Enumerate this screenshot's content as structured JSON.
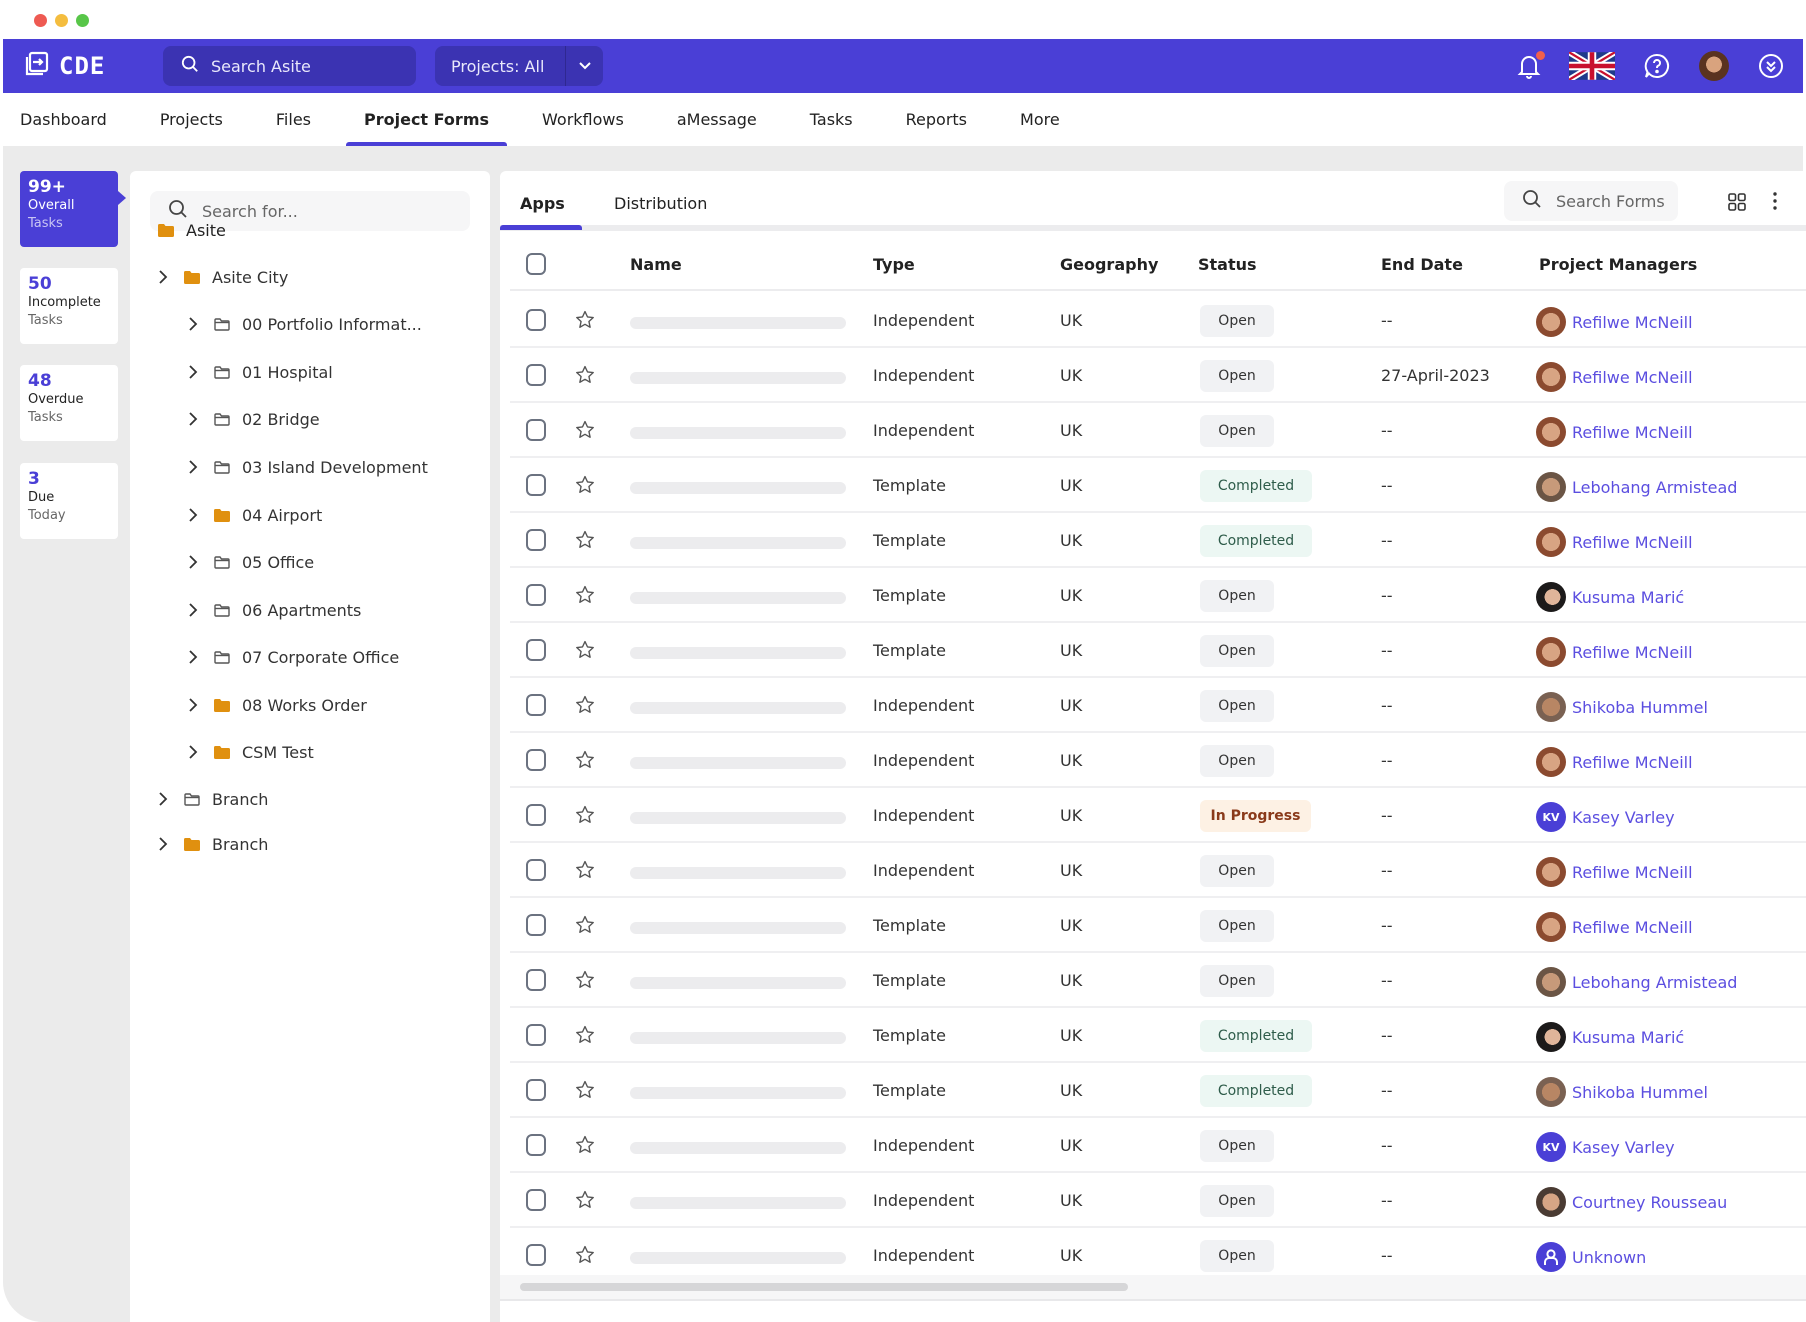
{
  "header": {
    "logo_text": "CDE",
    "search_placeholder": "Search Asite",
    "projects_filter": "Projects: All",
    "icons": [
      "bell-icon",
      "uk-flag-icon",
      "help-icon",
      "user-avatar",
      "chevrons-down-icon"
    ]
  },
  "nav": {
    "items": [
      {
        "label": "Dashboard"
      },
      {
        "label": "Projects"
      },
      {
        "label": "Files"
      },
      {
        "label": "Project Forms",
        "active": true
      },
      {
        "label": "Workflows"
      },
      {
        "label": "aMessage"
      },
      {
        "label": "Tasks"
      },
      {
        "label": "Reports"
      },
      {
        "label": "More"
      }
    ]
  },
  "stats": [
    {
      "value": "99+",
      "line1": "Overall",
      "line2": "Tasks",
      "active": true
    },
    {
      "value": "50",
      "line1": "Incomplete",
      "line2": "Tasks"
    },
    {
      "value": "48",
      "line1": "Overdue",
      "line2": "Tasks"
    },
    {
      "value": "3",
      "line1": "Due",
      "line2": "Today"
    }
  ],
  "tree": {
    "search_placeholder": "Search for...",
    "items": [
      {
        "label": "Asite",
        "level": 0,
        "folder": "filled",
        "chevron": false
      },
      {
        "label": "Asite City",
        "level": 1,
        "folder": "filled",
        "chevron": true
      },
      {
        "label": "00 Portfolio Informat...",
        "level": 2,
        "folder": "outline",
        "chevron": true
      },
      {
        "label": "01 Hospital",
        "level": 2,
        "folder": "outline",
        "chevron": true
      },
      {
        "label": "02 Bridge",
        "level": 2,
        "folder": "outline",
        "chevron": true
      },
      {
        "label": "03 Island Development",
        "level": 2,
        "folder": "outline",
        "chevron": true
      },
      {
        "label": "04 Airport",
        "level": 2,
        "folder": "filled",
        "chevron": true
      },
      {
        "label": "05 Office",
        "level": 2,
        "folder": "outline",
        "chevron": true
      },
      {
        "label": "06 Apartments",
        "level": 2,
        "folder": "outline",
        "chevron": true
      },
      {
        "label": "07 Corporate Office",
        "level": 2,
        "folder": "outline",
        "chevron": true
      },
      {
        "label": "08 Works Order",
        "level": 2,
        "folder": "filled",
        "chevron": true
      },
      {
        "label": "CSM Test",
        "level": 2,
        "folder": "filled",
        "chevron": true
      },
      {
        "label": "Branch",
        "level": 1,
        "folder": "outline",
        "chevron": true
      },
      {
        "label": "Branch",
        "level": 1,
        "folder": "filled",
        "chevron": true
      }
    ]
  },
  "main": {
    "tabs": [
      {
        "label": "Apps",
        "active": true
      },
      {
        "label": "Distribution"
      }
    ],
    "search_placeholder": "Search Forms",
    "columns": {
      "name": "Name",
      "type": "Type",
      "geography": "Geography",
      "status": "Status",
      "end_date": "End Date",
      "project_managers": "Project Managers"
    },
    "rows": [
      {
        "type": "Independent",
        "geography": "UK",
        "status": "Open",
        "end_date": "--",
        "pm": "Refilwe McNeill",
        "avatar": "photo1"
      },
      {
        "type": "Independent",
        "geography": "UK",
        "status": "Open",
        "end_date": "27-April-2023",
        "pm": "Refilwe McNeill",
        "avatar": "photo1"
      },
      {
        "type": "Independent",
        "geography": "UK",
        "status": "Open",
        "end_date": "--",
        "pm": "Refilwe McNeill",
        "avatar": "photo1"
      },
      {
        "type": "Template",
        "geography": "UK",
        "status": "Completed",
        "end_date": "--",
        "pm": "Lebohang Armistead",
        "avatar": "photo2"
      },
      {
        "type": "Template",
        "geography": "UK",
        "status": "Completed",
        "end_date": "--",
        "pm": "Refilwe McNeill",
        "avatar": "photo1"
      },
      {
        "type": "Template",
        "geography": "UK",
        "status": "Open",
        "end_date": "--",
        "pm": "Kusuma Marić",
        "avatar": "photo3"
      },
      {
        "type": "Template",
        "geography": "UK",
        "status": "Open",
        "end_date": "--",
        "pm": "Refilwe McNeill",
        "avatar": "photo1"
      },
      {
        "type": "Independent",
        "geography": "UK",
        "status": "Open",
        "end_date": "--",
        "pm": "Shikoba Hummel",
        "avatar": "photo4"
      },
      {
        "type": "Independent",
        "geography": "UK",
        "status": "Open",
        "end_date": "--",
        "pm": "Refilwe McNeill",
        "avatar": "photo1"
      },
      {
        "type": "Independent",
        "geography": "UK",
        "status": "In Progress",
        "end_date": "--",
        "pm": "Kasey Varley",
        "avatar": "initials",
        "initials": "KV"
      },
      {
        "type": "Independent",
        "geography": "UK",
        "status": "Open",
        "end_date": "--",
        "pm": "Refilwe McNeill",
        "avatar": "photo1"
      },
      {
        "type": "Template",
        "geography": "UK",
        "status": "Open",
        "end_date": "--",
        "pm": "Refilwe McNeill",
        "avatar": "photo1"
      },
      {
        "type": "Template",
        "geography": "UK",
        "status": "Open",
        "end_date": "--",
        "pm": "Lebohang Armistead",
        "avatar": "photo2"
      },
      {
        "type": "Template",
        "geography": "UK",
        "status": "Completed",
        "end_date": "--",
        "pm": "Kusuma Marić",
        "avatar": "photo3"
      },
      {
        "type": "Template",
        "geography": "UK",
        "status": "Completed",
        "end_date": "--",
        "pm": "Shikoba Hummel",
        "avatar": "photo4"
      },
      {
        "type": "Independent",
        "geography": "UK",
        "status": "Open",
        "end_date": "--",
        "pm": "Kasey Varley",
        "avatar": "initials",
        "initials": "KV"
      },
      {
        "type": "Independent",
        "geography": "UK",
        "status": "Open",
        "end_date": "--",
        "pm": "Courtney Rousseau",
        "avatar": "photo5"
      },
      {
        "type": "Independent",
        "geography": "UK",
        "status": "Open",
        "end_date": "--",
        "pm": "Unknown",
        "avatar": "unknown"
      }
    ]
  },
  "colors": {
    "brand": "#4a3fd6",
    "link": "#5b4ee0",
    "folder": "#e0900f",
    "status_open_bg": "#f1f2f4",
    "status_completed_bg": "#ecf7f3",
    "status_inprogress_bg": "#fdf1e4"
  }
}
